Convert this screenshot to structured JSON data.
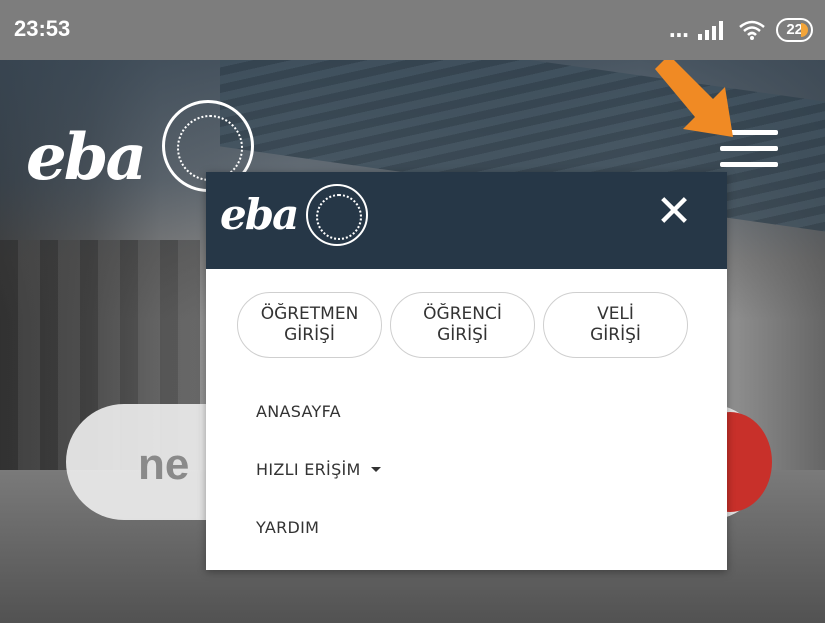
{
  "status_bar": {
    "time": "23:53",
    "signal_dots": "...",
    "battery": "22"
  },
  "hero": {
    "logo_text": "eba",
    "search_text": "ne"
  },
  "menu": {
    "logo_text": "eba",
    "close_symbol": "✕",
    "login_buttons": [
      {
        "label": "ÖĞRETMEN\nGİRİŞİ"
      },
      {
        "label": "ÖĞRENCİ\nGİRİŞİ"
      },
      {
        "label": "VELİ\nGİRİŞİ"
      }
    ],
    "nav_items": [
      {
        "label": "ANASAYFA"
      },
      {
        "label": "HIZLI ERİŞİM"
      },
      {
        "label": "YARDIM"
      }
    ]
  },
  "colors": {
    "header": "#263747",
    "arrow": "#f08a24",
    "search_button": "#c8302a"
  }
}
